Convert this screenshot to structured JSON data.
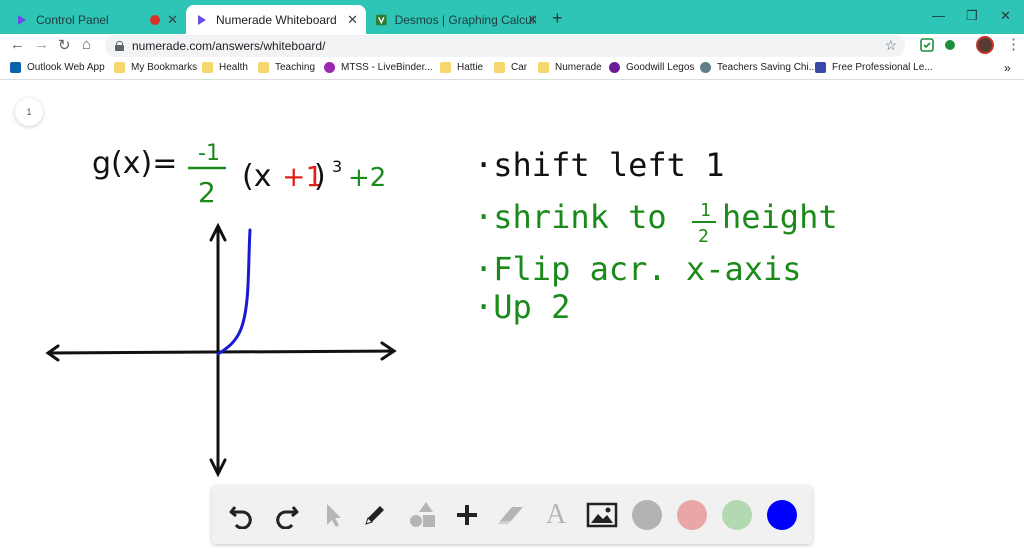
{
  "browser": {
    "tabs": [
      {
        "title": "Control Panel",
        "recording": true
      },
      {
        "title": "Numerade Whiteboard",
        "active": true
      },
      {
        "title": "Desmos | Graphing Calculator"
      }
    ],
    "tab_close_glyph": "✕",
    "new_tab_glyph": "+",
    "window_controls": {
      "minimize": "—",
      "restore": "❐",
      "close": "✕"
    },
    "nav": {
      "back": "←",
      "forward": "→",
      "reload": "↻",
      "home": "⌂"
    },
    "address": "numerade.com/answers/whiteboard/",
    "star_glyph": "☆",
    "bookmarks": [
      {
        "label": "Outlook Web App",
        "icon": "outlook-icon"
      },
      {
        "label": "My Bookmarks",
        "icon": "folder-icon"
      },
      {
        "label": "Health",
        "icon": "folder-icon"
      },
      {
        "label": "Teaching",
        "icon": "folder-icon"
      },
      {
        "label": "MTSS - LiveBinder...",
        "icon": "livebinder-icon"
      },
      {
        "label": "Hattie",
        "icon": "folder-icon"
      },
      {
        "label": "Car",
        "icon": "folder-icon"
      },
      {
        "label": "Numerade",
        "icon": "folder-icon"
      },
      {
        "label": "Goodwill Legos",
        "icon": "goodwill-icon"
      },
      {
        "label": "Teachers Saving Chi...",
        "icon": "globe-icon"
      },
      {
        "label": "Free Professional Le...",
        "icon": "grid-icon"
      }
    ],
    "more_bookmarks": "»"
  },
  "whiteboard": {
    "page_number": "1",
    "equation": {
      "lhs": "g(x)=",
      "coef_num": "-1",
      "coef_den": "2",
      "open": "(x",
      "shift": "+1",
      "close": ")",
      "power": "3",
      "vshift": "+2"
    },
    "notes": [
      {
        "text": "·shift left 1",
        "color": "#111111"
      },
      {
        "text": "·shrink to ",
        "frac_num": "1",
        "frac_den": "2",
        "suffix": "height",
        "color": "#1a8a1a"
      },
      {
        "text": "·Flip acr. x-axis",
        "color": "#1a8a1a"
      },
      {
        "text": "·Up 2",
        "color": "#1a8a1a"
      }
    ],
    "ink_colors": {
      "black": "#111111",
      "red": "#e0201c",
      "green": "#1a8a1a",
      "blue": "#1a1ad0"
    }
  },
  "tools": {
    "undo": "undo-icon",
    "redo": "redo-icon",
    "select": "pointer-icon",
    "pen": "pencil-icon",
    "shapes": "shapes-icon",
    "add": "plus-icon",
    "eraser": "eraser-icon",
    "text": "A",
    "image": "image-icon",
    "swatches": [
      "#b3b3b3",
      "#e8a6a6",
      "#b3d9b3",
      "#0000ff"
    ]
  }
}
